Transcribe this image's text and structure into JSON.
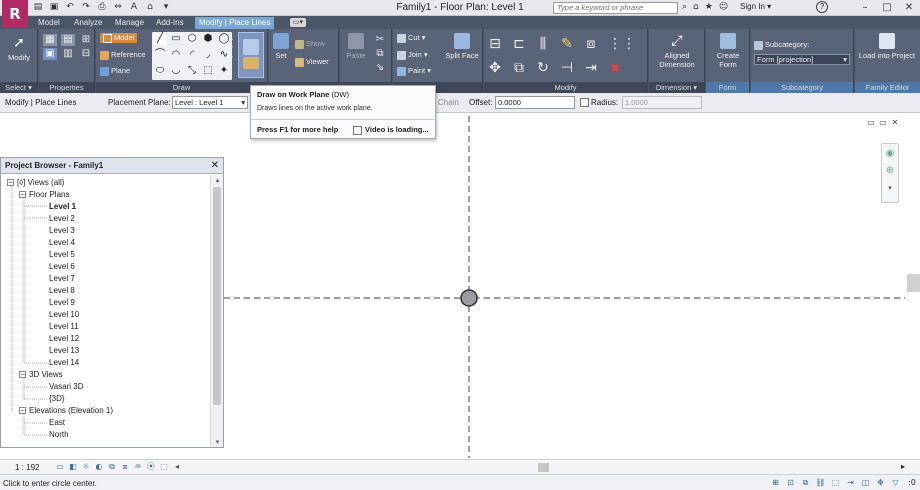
{
  "app": {
    "logo": "R"
  },
  "title_bar": {
    "document_title": "Family1 - Floor Plan: Level 1",
    "search_placeholder": "Type a keyword or phrase",
    "sign_in": "Sign In",
    "help": "?"
  },
  "ribbon_tabs": [
    {
      "label": "Model"
    },
    {
      "label": "Analyze"
    },
    {
      "label": "Manage"
    },
    {
      "label": "Add-Ins"
    },
    {
      "label": "Modify | Place Lines",
      "active": true
    }
  ],
  "ribbon": {
    "select": {
      "button": "Modify",
      "panel_label": "Select"
    },
    "properties": {
      "panel_label": "Properties"
    },
    "draw": {
      "panel_label": "Draw",
      "model": "Model",
      "reference": "Reference",
      "plane": "Plane"
    },
    "work_plane": {
      "set": "Set",
      "show": "Show",
      "viewer": "Viewer"
    },
    "clipboard": {
      "paste": "Paste"
    },
    "geometry": {
      "cut": "Cut",
      "join": "Join",
      "paint": "Paint",
      "split_face": "Split Face",
      "panel_label_partial": "ometry"
    },
    "modify": {
      "panel_label": "Modify"
    },
    "measure": {
      "aligned_dimension": "Aligned Dimension",
      "panel_label": "Dimension"
    },
    "form": {
      "create_form": "Create Form",
      "panel_label": "Form"
    },
    "subcategory": {
      "label": "Subcategory:",
      "value": "Form [projection]",
      "panel_label": "Subcategory"
    },
    "family_editor": {
      "load_into_project": "Load into Project",
      "panel_label": "Family Editor"
    }
  },
  "options_bar": {
    "context": "Modify | Place Lines",
    "placement_plane_label": "Placement Plane:",
    "placement_plane_value": "Level : Level 1",
    "chain_label": "Chain",
    "offset_label": "Offset:",
    "offset_value": "0.0000",
    "radius_label": "Radius:",
    "radius_value": "1.0000"
  },
  "tooltip": {
    "title": "Draw on Work Plane",
    "shortcut": "(DW)",
    "description": "Draws lines on the active work plane.",
    "help": "Press F1 for more help",
    "video": "Video is loading..."
  },
  "project_browser": {
    "title": "Project Browser - Family1",
    "tree": {
      "views_all": "Views (all)",
      "floor_plans": "Floor Plans",
      "levels": [
        "Level 1",
        "Level 2",
        "Level 3",
        "Level 4",
        "Level 5",
        "Level 6",
        "Level 7",
        "Level 8",
        "Level 9",
        "Level 10",
        "Level 11",
        "Level 12",
        "Level 13",
        "Level 14"
      ],
      "views_3d": "3D Views",
      "views_3d_items": [
        "Vasari 3D",
        "{3D}"
      ],
      "elevations": "Elevations (Elevation 1)",
      "elevation_items": [
        "East",
        "North"
      ]
    }
  },
  "view_control": {
    "scale": "1 : 192"
  },
  "status_bar": {
    "message": "Click to enter circle center.",
    "filter_count": ":0"
  },
  "colors": {
    "title_bg": "#e8e8ec",
    "ribbon_bg": "#4a5469",
    "active_tab": "#79a8d8",
    "logo": "#b02a66",
    "canvas_bg": "#ffffff",
    "ref_line": "#404040"
  }
}
